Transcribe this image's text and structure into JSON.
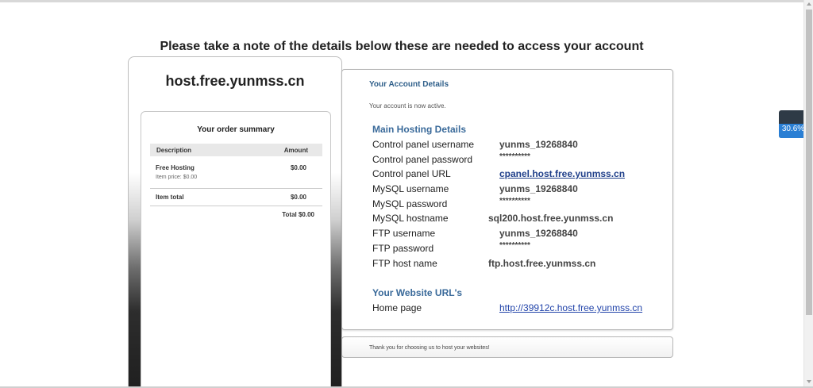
{
  "page": {
    "heading": "Please take a note of the details below these are needed to access your account"
  },
  "order": {
    "host_title": "host.free.yunmss.cn",
    "summary_title": "Your order summary",
    "columns": {
      "description": "Description",
      "amount": "Amount"
    },
    "item": {
      "name": "Free Hosting",
      "price_note": "Item price: $0.00",
      "amount": "$0.00"
    },
    "item_total": {
      "label": "Item total",
      "amount": "$0.00"
    },
    "total": "Total $0.00"
  },
  "account": {
    "heading": "Your Account Details",
    "status": "Your account is now active.",
    "hosting_title": "Main Hosting Details",
    "rows": [
      {
        "label": "Control panel username",
        "value": "yunms_19268840"
      },
      {
        "label": "Control panel password",
        "value": "**********"
      },
      {
        "label": "Control panel URL",
        "value": "cpanel.host.free.yunmss.cn"
      },
      {
        "label": "MySQL username",
        "value": "yunms_19268840"
      },
      {
        "label": "MySQL password",
        "value": "**********"
      },
      {
        "label": "MySQL hostname",
        "value": "sql200.host.free.yunmss.cn"
      },
      {
        "label": "FTP username",
        "value": "yunms_19268840"
      },
      {
        "label": "FTP password",
        "value": "**********"
      },
      {
        "label": "FTP host name",
        "value": "ftp.host.free.yunmss.cn"
      }
    ],
    "website_title": "Your Website URL's",
    "home_page_label": "Home page",
    "home_page_url": "http://39912c.host.free.yunmss.cn"
  },
  "footer": {
    "thanks": "Thank you for choosing us to host your websites!"
  },
  "badge": {
    "label": "30.6%",
    "progress": 0.306
  },
  "colors": {
    "accent": "#3a6a9a",
    "link": "#1f3f8a",
    "badge": "#2a7fd4"
  }
}
